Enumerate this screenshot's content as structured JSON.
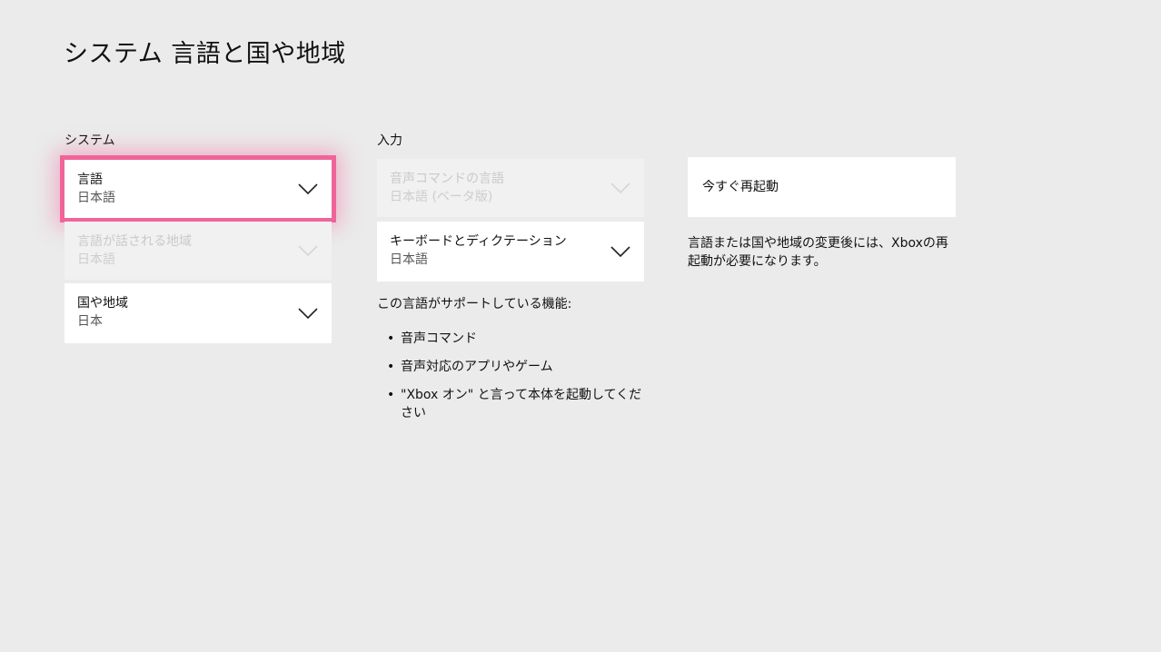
{
  "header": {
    "title": "システム  言語と国や地域"
  },
  "system_section": {
    "label": "システム",
    "dropdowns": [
      {
        "label": "言語",
        "value": "日本語"
      },
      {
        "label": "言語が話される地域",
        "value": "日本語"
      },
      {
        "label": "国や地域",
        "value": "日本"
      }
    ]
  },
  "input_section": {
    "label": "入力",
    "dropdowns": [
      {
        "label": "音声コマンドの言語",
        "value": "日本語 (ベータ版)"
      },
      {
        "label": "キーボードとディクテーション",
        "value": "日本語"
      }
    ],
    "features_heading": "この言語がサポートしている機能:",
    "features": [
      "音声コマンド",
      "音声対応のアプリやゲーム",
      "\"Xbox オン\" と言って本体を起動してください"
    ],
    "bullet": "•"
  },
  "restart": {
    "button_label": "今すぐ再起動",
    "note": "言語または国や地域の変更後には、Xboxの再起動が必要になります。"
  },
  "colors": {
    "background": "#ebebeb",
    "focus_highlight": "#f0649a"
  },
  "icons": {
    "dropdown": "chevron-down-icon"
  }
}
